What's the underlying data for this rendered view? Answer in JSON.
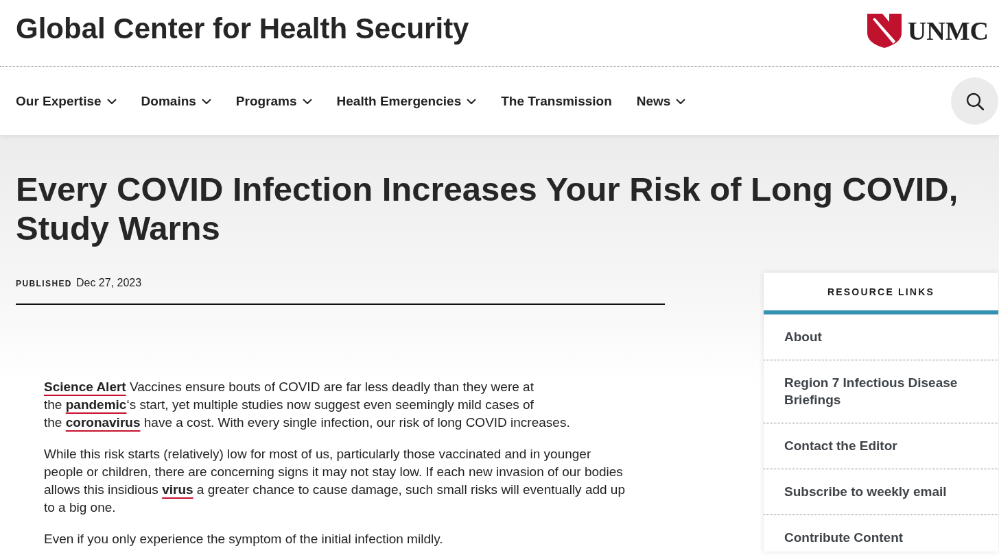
{
  "site": {
    "title": "Global Center for Health Security",
    "logo_text": "UNMC"
  },
  "nav": {
    "items": [
      {
        "label": "Our Expertise",
        "dropdown": true
      },
      {
        "label": "Domains",
        "dropdown": true
      },
      {
        "label": "Programs",
        "dropdown": true
      },
      {
        "label": "Health Emergencies",
        "dropdown": true
      },
      {
        "label": "The Transmission",
        "dropdown": false
      },
      {
        "label": "News",
        "dropdown": true
      }
    ]
  },
  "article": {
    "title": "Every COVID Infection Increases Your Risk of Long COVID, Study Warns",
    "published_label": "PUBLISHED",
    "published_date": "Dec 27, 2023",
    "paragraphs": [
      [
        {
          "kind": "link",
          "text": "Science Alert"
        },
        {
          "kind": "text",
          "text": " Vaccines ensure bouts of COVID are far less deadly than they were at\nthe "
        },
        {
          "kind": "link",
          "text": "pandemic"
        },
        {
          "kind": "text",
          "text": "‘s start, yet multiple studies now suggest even seemingly mild cases of\nthe "
        },
        {
          "kind": "link",
          "text": "coronavirus"
        },
        {
          "kind": "text",
          "text": " have a cost. With every single infection, our risk of long COVID increases."
        }
      ],
      [
        {
          "kind": "text",
          "text": "While this risk starts (relatively) low for most of us, particularly those vaccinated and in younger people or children, there are concerning signs it may not stay low. If each new invasion of our bodies allows this insidious "
        },
        {
          "kind": "link",
          "text": "virus"
        },
        {
          "kind": "text",
          "text": " a greater chance to cause damage, such small risks will eventually add up to a big one."
        }
      ],
      [
        {
          "kind": "text",
          "text": "Even if you only experience the symptom of the initial infection mildly."
        }
      ]
    ]
  },
  "sidebar": {
    "title": "RESOURCE LINKS",
    "links": [
      "About",
      "Region 7 Infectious Disease Briefings",
      "Contact the Editor",
      "Subscribe to weekly email",
      "Contribute Content"
    ]
  }
}
